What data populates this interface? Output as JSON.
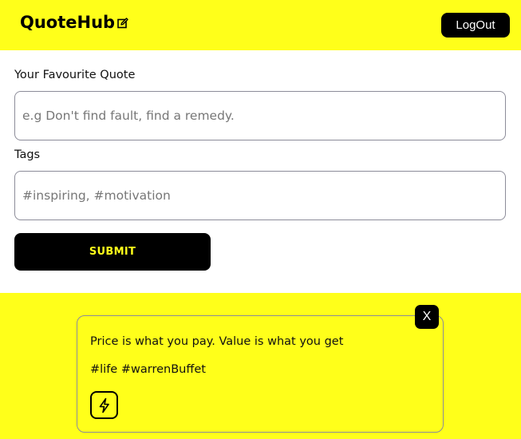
{
  "header": {
    "brand": "QuoteHub",
    "brand_icon": "edit-icon",
    "logout_label": "LogOut",
    "background": "#ffff1a"
  },
  "form": {
    "quote_label": "Your Favourite Quote",
    "quote_placeholder": "e.g Don't find fault, find a remedy.",
    "quote_value": "",
    "tags_label": "Tags",
    "tags_placeholder": "#inspiring, #motivation",
    "tags_value": "",
    "submit_label": "SUBMIT"
  },
  "quotes": [
    {
      "text": "Price is what you pay. Value is what you get",
      "tags": "#life #warrenBuffet",
      "close_label": "X",
      "action_icon": "bolt-icon"
    }
  ]
}
